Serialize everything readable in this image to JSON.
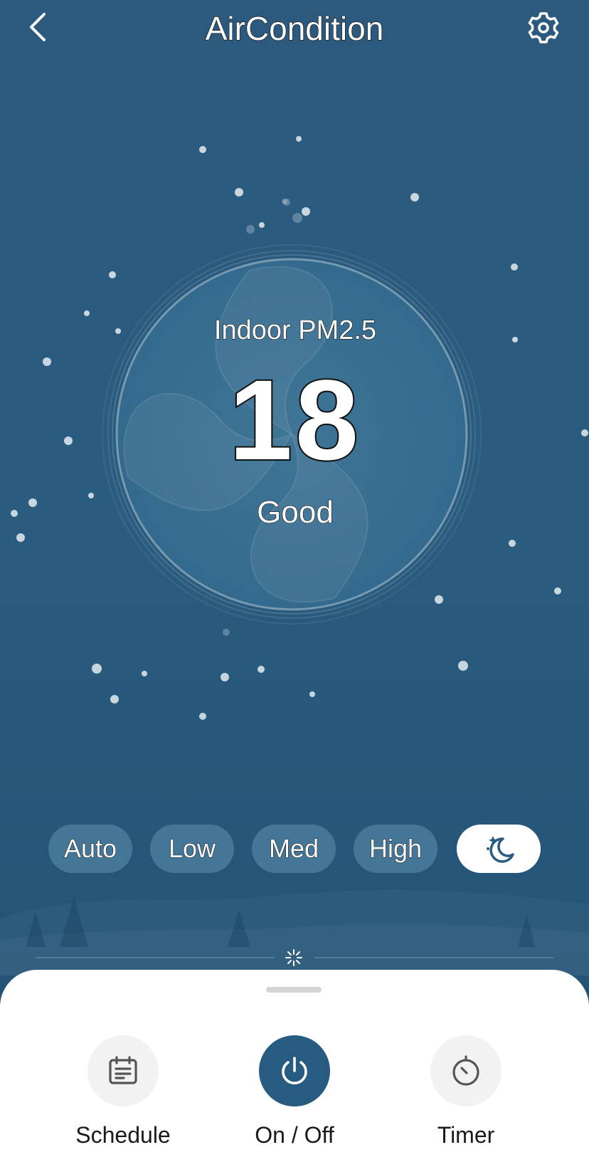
{
  "header": {
    "title": "AirCondition",
    "back_icon": "chevron-left-icon",
    "settings_icon": "gear-icon"
  },
  "reading": {
    "label": "Indoor PM2.5",
    "value": "18",
    "status": "Good"
  },
  "modes": {
    "items": [
      {
        "label": "Auto",
        "active": false
      },
      {
        "label": "Low",
        "active": false
      },
      {
        "label": "Med",
        "active": false
      },
      {
        "label": "High",
        "active": false
      },
      {
        "label": "",
        "icon": "moon-sleep-icon",
        "active": true
      }
    ]
  },
  "actions": {
    "schedule": {
      "label": "Schedule",
      "icon": "calendar-icon"
    },
    "power": {
      "label": "On / Off",
      "icon": "power-icon"
    },
    "timer": {
      "label": "Timer",
      "icon": "timer-icon"
    }
  },
  "colors": {
    "background": "#2b5a7e",
    "accent": "#285b80",
    "sheet": "#ffffff"
  }
}
